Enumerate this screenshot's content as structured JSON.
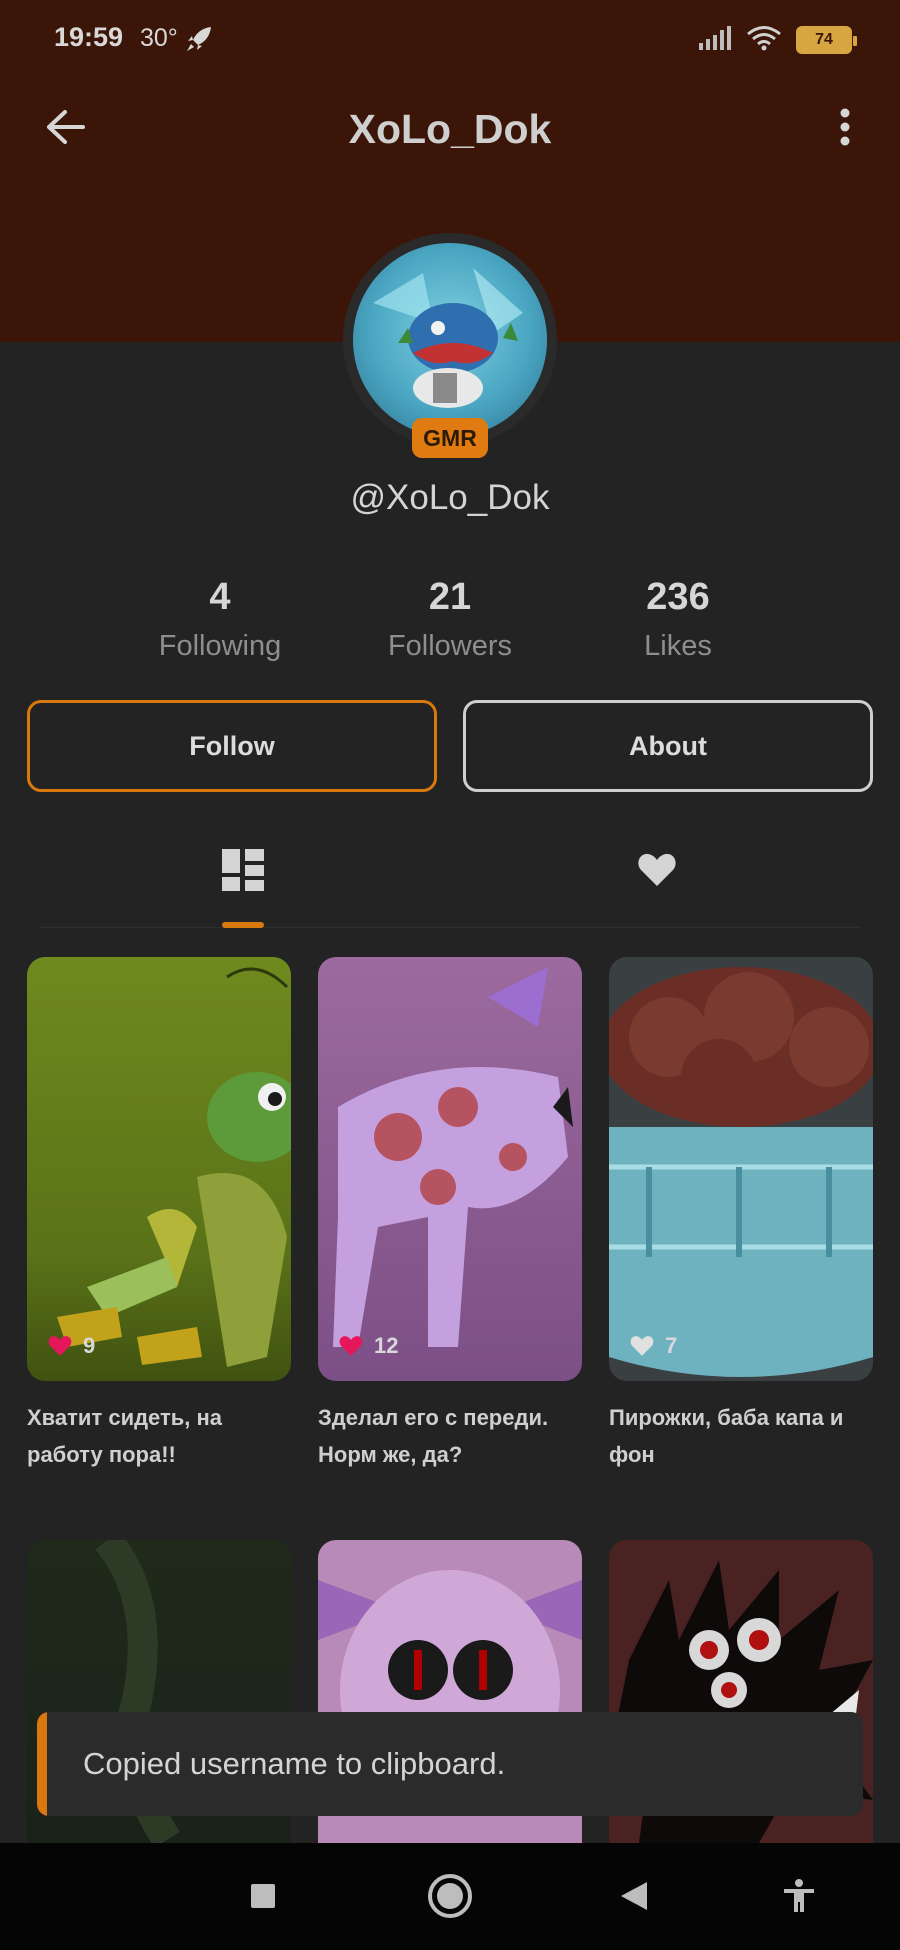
{
  "status_bar": {
    "time": "19:59",
    "temperature": "30°",
    "battery": "74",
    "icons": [
      "rocket-icon",
      "signal-icon",
      "wifi-icon",
      "battery-icon"
    ]
  },
  "top_bar": {
    "title": "XoLo_Dok",
    "icons": [
      "back-arrow-icon",
      "more-vertical-icon"
    ]
  },
  "profile": {
    "badge": "GMR",
    "handle": "@XoLo_Dok"
  },
  "stats": [
    {
      "value": "4",
      "label": "Following"
    },
    {
      "value": "21",
      "label": "Followers"
    },
    {
      "value": "236",
      "label": "Likes"
    }
  ],
  "actions": {
    "follow_label": "Follow",
    "about_label": "About"
  },
  "tabs": [
    {
      "icon": "grid-icon",
      "selected": true
    },
    {
      "icon": "heart-icon",
      "selected": false
    }
  ],
  "posts": [
    {
      "likes": "9",
      "caption": "Хватит сидеть, на работу пора!!",
      "liked": true
    },
    {
      "likes": "12",
      "caption": "Зделал его с переди. Норм же, да?",
      "liked": true
    },
    {
      "likes": "7",
      "caption": "Пирожки, баба капа и фон",
      "liked": false
    },
    {
      "likes": "",
      "caption": "",
      "liked": false
    },
    {
      "likes": "",
      "caption": "",
      "liked": false
    },
    {
      "likes": "",
      "caption": "",
      "liked": false
    }
  ],
  "toast": {
    "message": "Copied username to clipboard."
  },
  "nav_bar": {
    "icons": [
      "square-icon",
      "home-circle-icon",
      "back-triangle-icon",
      "accessibility-icon"
    ]
  },
  "colors": {
    "accent": "#d9780f",
    "header": "#3a1508",
    "background": "#232323",
    "like_heart": "#e5175a"
  }
}
